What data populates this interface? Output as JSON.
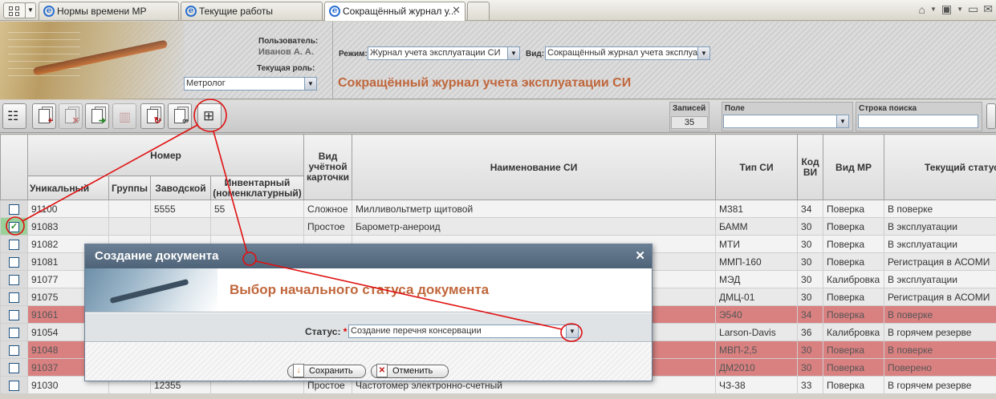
{
  "browser": {
    "tabs": [
      {
        "label": "Нормы времени МР",
        "active": false
      },
      {
        "label": "Текущие работы",
        "active": false
      },
      {
        "label": "Сокращённый журнал у...",
        "active": true
      }
    ]
  },
  "header": {
    "user_label": "Пользователь:",
    "user_name": "Иванов А. А.",
    "role_label": "Текущая роль:",
    "role_value": "Метролог",
    "mode_label": "Режим:",
    "mode_value": "Журнал учета эксплуатации СИ",
    "view_label": "Вид:",
    "view_value": "Сокращённый журнал учета эксплуа",
    "page_title": "Сокращённый журнал учета эксплуатации СИ"
  },
  "toolbar": {
    "records_label": "Записей",
    "records_count": "35",
    "field_label": "Поле",
    "search_label": "Строка поиска"
  },
  "table": {
    "group_header": "Номер",
    "columns": {
      "unique": "Уникальный",
      "groups": "Группы",
      "factory": "Заводской",
      "inventory": "Инвентарный (номенклатурный)",
      "card_type": "Вид учётной карточки",
      "name": "Наименование СИ",
      "si_type": "Тип СИ",
      "vi_code": "Код ВИ",
      "mr_type": "Вид МР",
      "status": "Текущий статус"
    },
    "rows": [
      {
        "unique": "91100",
        "groups": "",
        "factory": "5555",
        "inventory": "55",
        "card": "Сложное",
        "name": "Милливольтметр щитовой",
        "type": "М381",
        "code": "34",
        "mr": "Поверка",
        "status": "В поверке",
        "style": "normal",
        "checked": false
      },
      {
        "unique": "91083",
        "groups": "",
        "factory": "",
        "inventory": "",
        "card": "Простое",
        "name": "Барометр-анероид",
        "type": "БАММ",
        "code": "30",
        "mr": "Поверка",
        "status": "В эксплуатации",
        "style": "alt",
        "checked": true
      },
      {
        "unique": "91082",
        "groups": "",
        "factory": "",
        "inventory": "",
        "card": "",
        "name": "",
        "type": "МТИ",
        "code": "30",
        "mr": "Поверка",
        "status": "В эксплуатации",
        "style": "normal",
        "checked": false
      },
      {
        "unique": "91081",
        "groups": "",
        "factory": "",
        "inventory": "",
        "card": "",
        "name": "",
        "type": "ММП-160",
        "code": "30",
        "mr": "Поверка",
        "status": "Регистрация в АСОМИ",
        "style": "alt",
        "checked": false
      },
      {
        "unique": "91077",
        "groups": "",
        "factory": "",
        "inventory": "",
        "card": "",
        "name": "",
        "type": "МЭД",
        "code": "30",
        "mr": "Калибровка",
        "status": "В эксплуатации",
        "style": "normal",
        "checked": false
      },
      {
        "unique": "91075",
        "groups": "",
        "factory": "",
        "inventory": "",
        "card": "",
        "name": "",
        "type": "ДМЦ-01",
        "code": "30",
        "mr": "Поверка",
        "status": "Регистрация в АСОМИ",
        "style": "alt",
        "checked": false
      },
      {
        "unique": "91061",
        "groups": "",
        "factory": "",
        "inventory": "",
        "card": "",
        "name": "",
        "type": "Э540",
        "code": "34",
        "mr": "Поверка",
        "status": "В поверке",
        "style": "red",
        "checked": false
      },
      {
        "unique": "91054",
        "groups": "",
        "factory": "",
        "inventory": "",
        "card": "",
        "name": "",
        "type": "Larson-Davis",
        "code": "36",
        "mr": "Калибровка",
        "status": "В горячем резерве",
        "style": "alt",
        "checked": false
      },
      {
        "unique": "91048",
        "groups": "",
        "factory": "",
        "inventory": "",
        "card": "",
        "name": "",
        "type": "МВП-2,5",
        "code": "30",
        "mr": "Поверка",
        "status": "В поверке",
        "style": "red",
        "checked": false
      },
      {
        "unique": "91037",
        "groups": "",
        "factory": "",
        "inventory": "",
        "card": "",
        "name": "",
        "type": "ДМ2010",
        "code": "30",
        "mr": "Поверка",
        "status": "Поверено",
        "style": "red",
        "checked": false
      },
      {
        "unique": "91030",
        "groups": "",
        "factory": "12355",
        "inventory": "",
        "card": "Простое",
        "name": "Частотомер электронно-счетный",
        "type": "ЧЗ-38",
        "code": "33",
        "mr": "Поверка",
        "status": "В горячем резерве",
        "style": "normal",
        "checked": false
      }
    ]
  },
  "dialog": {
    "title": "Создание документа",
    "heading": "Выбор начального статуса документа",
    "status_label": "Статус:",
    "required_mark": "*",
    "status_value": "Создание перечня консервации",
    "save_label": "Сохранить",
    "cancel_label": "Отменить"
  },
  "colors": {
    "accent_title": "#c0673c",
    "dialog_bar": "#5a6e84",
    "annotation": "#e01010",
    "row_red": "#d98080"
  }
}
